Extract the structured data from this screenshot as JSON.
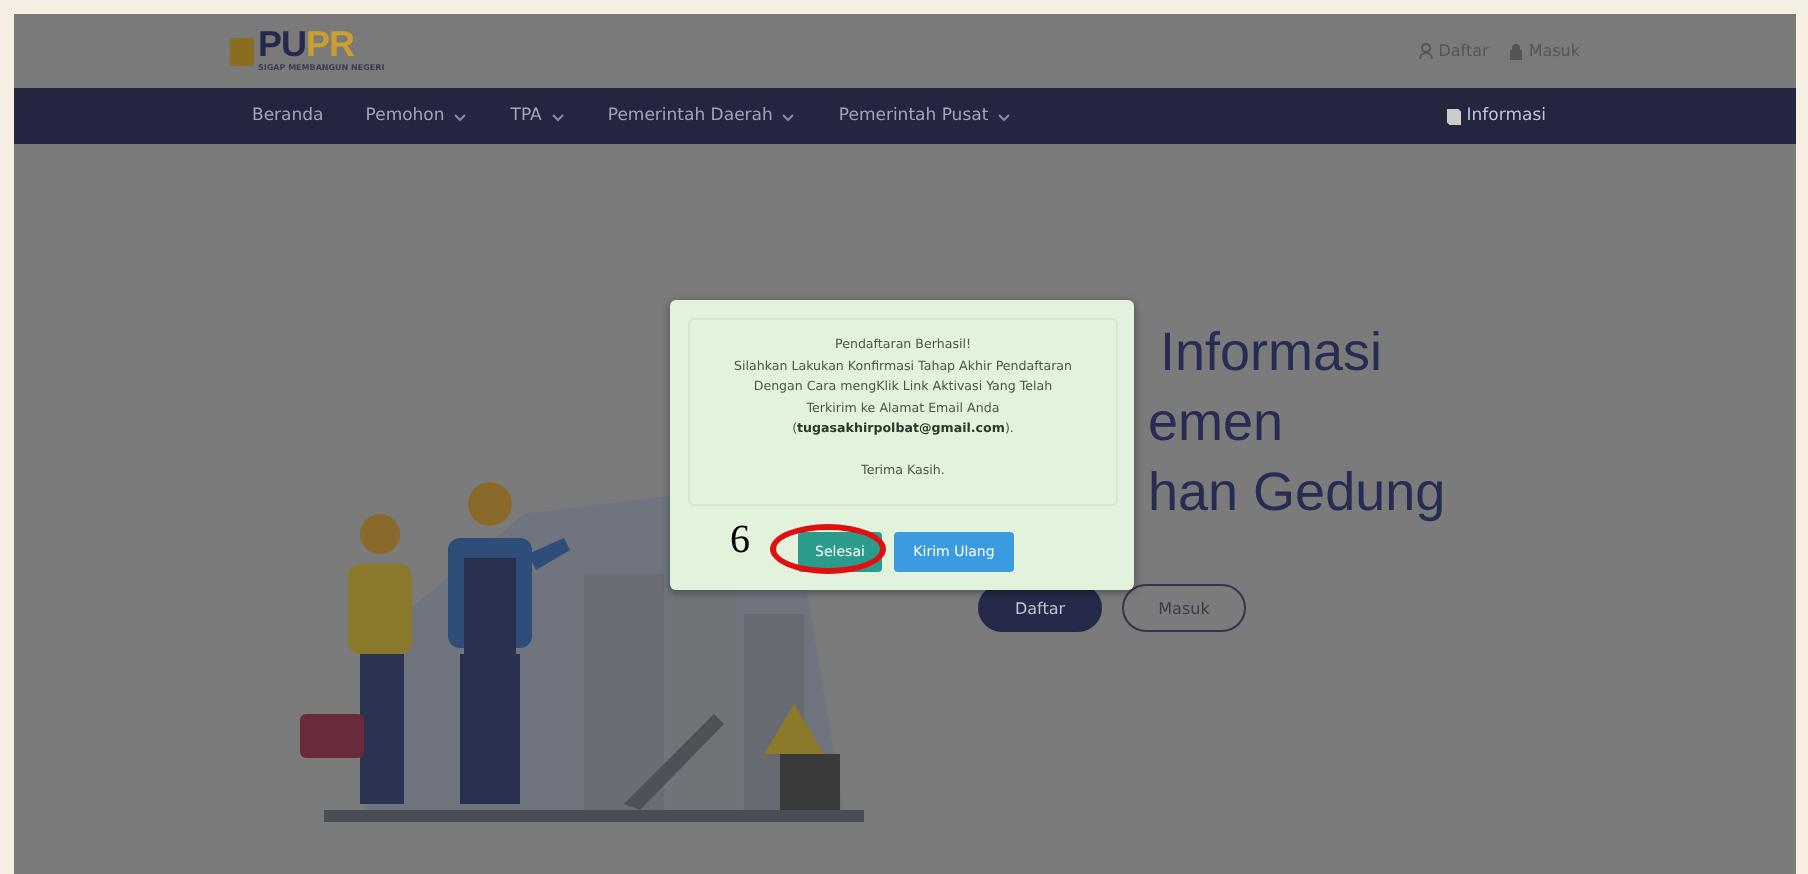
{
  "header": {
    "logo": {
      "parts": [
        "PU",
        "PR"
      ],
      "tagline": "SIGAP MEMBANGUN NEGERI"
    },
    "top_links": [
      {
        "kind": "user",
        "label": "Daftar"
      },
      {
        "kind": "lock",
        "label": "Masuk"
      }
    ]
  },
  "nav": {
    "items": [
      {
        "label": "Beranda",
        "dropdown": false
      },
      {
        "label": "Pemohon",
        "dropdown": true
      },
      {
        "label": "TPA",
        "dropdown": true
      },
      {
        "label": "Pemerintah Daerah",
        "dropdown": true
      },
      {
        "label": "Pemerintah Pusat",
        "dropdown": true
      }
    ],
    "info_link": "Informasi"
  },
  "hero": {
    "title_lines": [
      "Informasi",
      "emen",
      "han Gedung"
    ],
    "buttons": [
      {
        "label": "Daftar",
        "kind": "filled"
      },
      {
        "label": "Masuk",
        "kind": "outline"
      }
    ]
  },
  "modal": {
    "lines": [
      "Pendaftaran Berhasil!",
      "Silahkan Lakukan Konfirmasi Tahap Akhir Pendaftaran",
      "Dengan Cara mengKlik Link Aktivasi Yang Telah",
      "Terkirim ke Alamat Email Anda",
      "(**tugasakhirpolbat@gmail.com**).",
      "Terima Kasih."
    ],
    "buttons": [
      {
        "label": "Selesai",
        "kind": "success"
      },
      {
        "label": "Kirim Ulang",
        "kind": "info"
      }
    ]
  },
  "annotation": {
    "number": "6"
  }
}
